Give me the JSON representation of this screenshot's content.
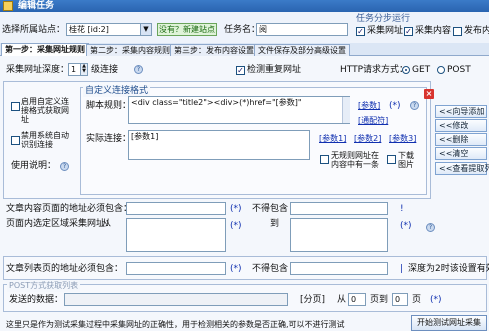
{
  "window": {
    "title": "编辑任务"
  },
  "top": {
    "site_label": "选择所属站点：",
    "site_value": "桂花 [id:2]",
    "new_site_button": "没有？新建站点",
    "task_name_label": "任务名：",
    "task_name_value": "阅",
    "steps_label": "任务分步运行",
    "step_collect_url": "采集网址",
    "step_collect_content": "采集内容",
    "step_publish": "发布内容"
  },
  "tabs": [
    "第一步：采集网址规则",
    "第二步：采集内容规则",
    "第三步：发布内容设置",
    "文件保存及部分高级设置"
  ],
  "url_depth": {
    "label": "采集网址深度：",
    "value": "1",
    "suffix": "级连接",
    "check_repeat_label": "检测重复网址",
    "http_label": "HTTP请求方式：",
    "get_label": "GET",
    "post_label": "POST"
  },
  "custom": {
    "group_title": "自定义连接格式",
    "enable_custom_label": "启用自定义连接格式获取网址",
    "disable_auto_label": "禁用系统自动识别连接",
    "usage_label": "使用说明：",
    "script_rule_label": "脚本规则：",
    "script_rule_value": "<div class=\"title2\"><div>(*)href=\"[参数]\"",
    "param_link": "[参数]",
    "wildcard_link": "[通配符]",
    "actual_link_label": "实际连接：",
    "actual_link_value": "[参数1]",
    "param1_link": "[参数1]",
    "param2_link": "[参数2]",
    "param3_link": "[参数3]",
    "no_url_in_list_label": "无规则网址在内容中有一条",
    "download_images_label": "下载图片"
  },
  "side_buttons": [
    "<<向导添加",
    "<<修改",
    "<<删除",
    "<<清空",
    "<<查看提取列"
  ],
  "content": {
    "must_contain_label": "文章内容页面的地址必须包含：",
    "not_contain_label": "不得包含",
    "region_label": "页面内选定区域采集网址：",
    "from_label": "从",
    "to_label": "到"
  },
  "list": {
    "must_contain_label": "文章列表页的地址必须包含：",
    "not_contain_label": "不得包含",
    "depth_note": "深度为2时该设置有效"
  },
  "post": {
    "group_title": "POST方式获取列表",
    "send_data_label": "发送的数据：",
    "page_label": "[分页]",
    "from_label": "从",
    "from_value": "0",
    "to_label": "页到",
    "to_value": "0",
    "page_suffix": "页"
  },
  "footer": {
    "note": "这里只是作为测试采集过程中采集网址的正确性，用于检测相关的参数是否正确,可以不进行测试",
    "test_button": "开始测试网址采集"
  }
}
